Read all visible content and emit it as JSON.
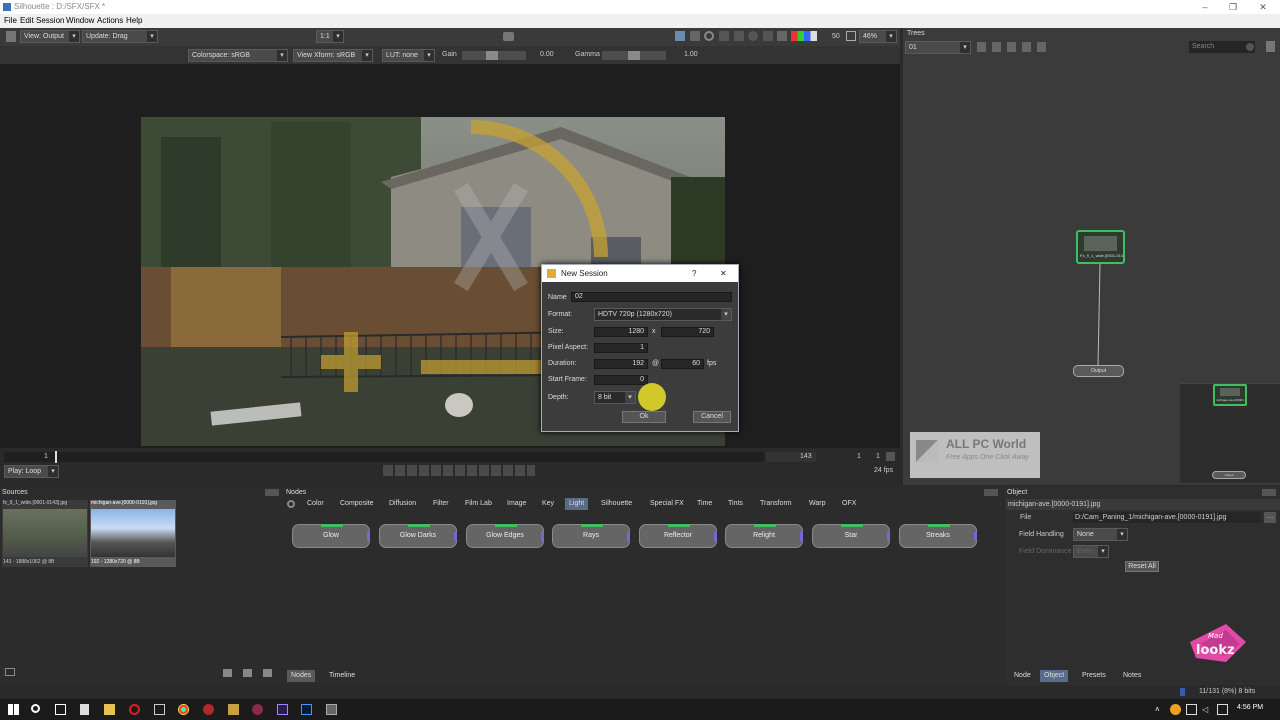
{
  "window": {
    "title": "Silhouette : D:/SFX/SFX *"
  },
  "menu": [
    "File",
    "Edit",
    "Session",
    "Window",
    "Actions",
    "Help"
  ],
  "viewer_toolbar": {
    "view": "View: Output",
    "update": "Update: Drag",
    "ratio": "1:1",
    "zoom_value": "50",
    "zoom_percent": "46%"
  },
  "options_bar": {
    "colorspace": "Colorspace: sRGB",
    "view_xform": "View Xform: sRGB",
    "lut": "LUT: none",
    "gain_label": "Gain",
    "gain_value": "0.00",
    "gamma_label": "Gamma",
    "gamma_value": "1.00"
  },
  "timeline": {
    "start_frame": "1",
    "end_frame": "143",
    "frame_a": "1",
    "frame_b": "1",
    "play_mode": "Play: Loop",
    "fps": "24 fps"
  },
  "trees": {
    "title": "Trees",
    "tree": "01",
    "search_placeholder": "Search",
    "node_label": "Fx_9_1_wide.[0001-0143].jpg",
    "output_label": "Output",
    "mini_node_label": "michigan-ave.[0000-0191].jpg",
    "mini_output_label": "Output"
  },
  "watermark": {
    "title": "ALL PC World",
    "subtitle": "Free Apps One Click Away"
  },
  "logo_text": "Mad lookz",
  "dialog": {
    "title": "New Session",
    "help": "?",
    "close": "✕",
    "name_label": "Name",
    "name_value": "02",
    "format_label": "Format:",
    "format_value": "HDTV 720p (1280x720)",
    "size_label": "Size:",
    "width": "1280",
    "x_sep": "x",
    "height": "720",
    "aspect_label": "Pixel Aspect:",
    "aspect_value": "1",
    "duration_label": "Duration:",
    "duration_value": "192",
    "at_sep": "@",
    "fps_value": "60",
    "fps_unit": "fps",
    "start_label": "Start Frame:",
    "start_value": "0",
    "depth_label": "Depth:",
    "depth_value": "8 bit",
    "ok": "Ok",
    "cancel": "Cancel"
  },
  "sources": {
    "title": "Sources",
    "items": [
      {
        "name": "fx_9_1_wide.[0001-0143].jpg",
        "info": "143 - 1888x1062 @ 8B"
      },
      {
        "name": "michigan-ave.[0000-0191].jpg",
        "info": "192 - 1280x720 @ 8B"
      }
    ]
  },
  "nodes": {
    "title": "Nodes",
    "categories": [
      "Color",
      "Composite",
      "Diffusion",
      "Filter",
      "Film Lab",
      "Image",
      "Key",
      "Light",
      "Silhouette",
      "Special FX",
      "Time",
      "Tints",
      "Transform",
      "Warp",
      "OFX"
    ],
    "active_category": "Light",
    "buttons": [
      "Glow",
      "Glow Darks",
      "Glow Edges",
      "Rays",
      "Reflector",
      "Relight",
      "Star",
      "Streaks"
    ],
    "bottom_tabs": [
      "Nodes",
      "Timeline"
    ]
  },
  "object": {
    "title": "Object",
    "node_name": "michigan-ave.[0000-0191].jpg",
    "file_label": "File",
    "file_value": "D:/Cam_Paning_1/michigan-ave.[0000-0191].jpg",
    "field_handling_label": "Field Handling",
    "field_handling_value": "None",
    "field_dominance_label": "Field Dominance",
    "field_dominance_value": "Even",
    "reset": "Reset All",
    "tabs": [
      "Node",
      "Object",
      "Presets",
      "Notes"
    ],
    "active_tab": "Object"
  },
  "status": {
    "memory": "11/131 (8%) 8 bits"
  },
  "taskbar": {
    "time": "4:56 PM"
  },
  "colors": {
    "accent_green": "#3fbf5f",
    "tab_active": "#5a6a8a",
    "dialog_bg": "#3c3c3c"
  }
}
